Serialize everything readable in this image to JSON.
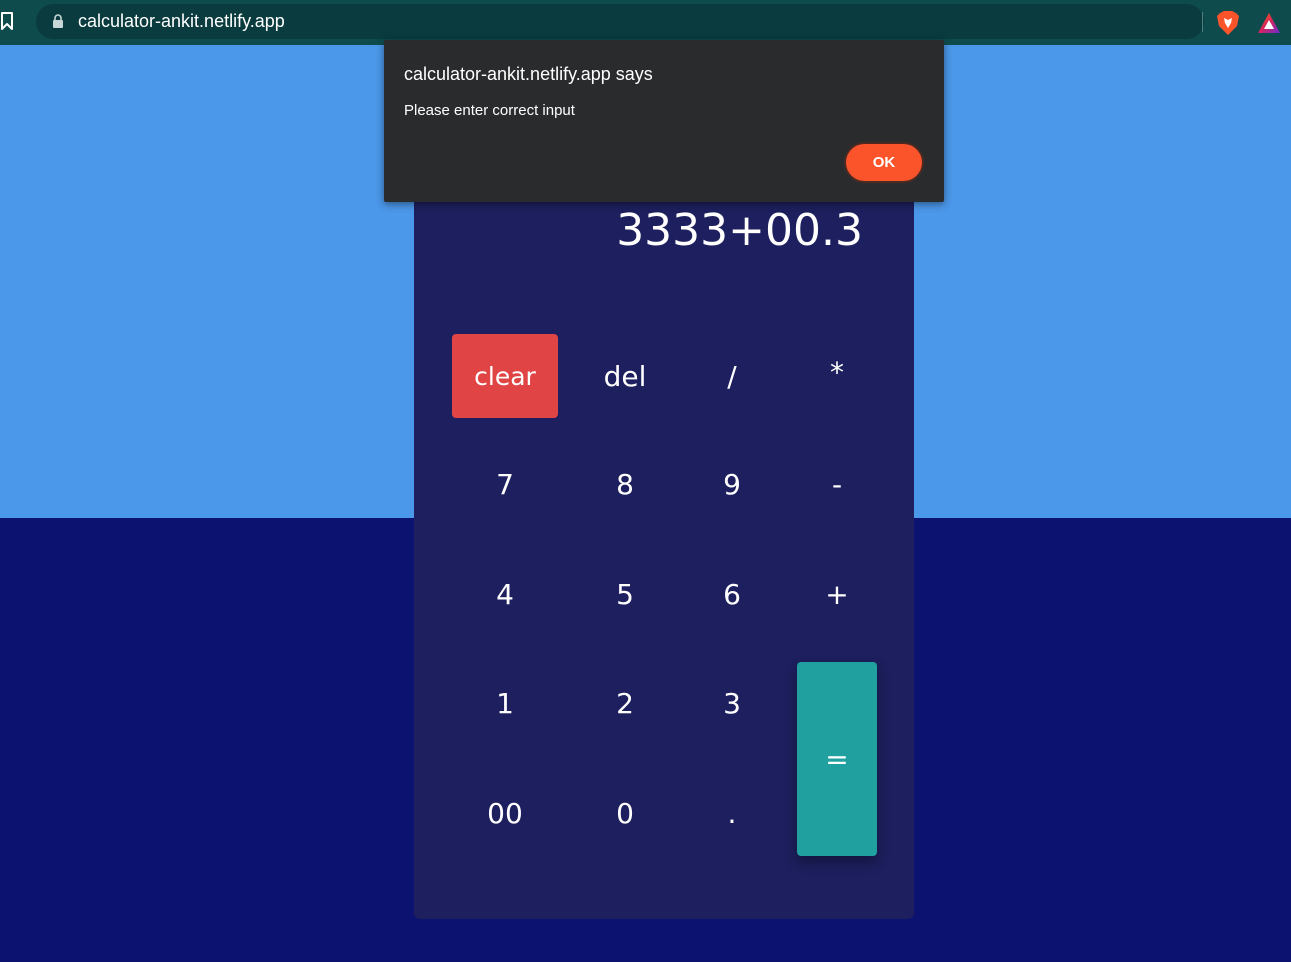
{
  "browser": {
    "url": "calculator-ankit.netlify.app",
    "icons": [
      "bookmark-icon",
      "lock-icon",
      "brave-shields-icon",
      "brave-rewards-icon"
    ]
  },
  "calculator": {
    "display_value": "3333+00.3",
    "keys": {
      "clear": "clear",
      "del": "del",
      "divide": "/",
      "multiply": "*",
      "seven": "7",
      "eight": "8",
      "nine": "9",
      "minus": "-",
      "four": "4",
      "five": "5",
      "six": "6",
      "plus": "+",
      "one": "1",
      "two": "2",
      "three": "3",
      "equals": "=",
      "double_zero": "00",
      "zero": "0",
      "decimal": "."
    }
  },
  "alert": {
    "title": "calculator-ankit.netlify.app says",
    "message": "Please enter correct input",
    "ok_label": "OK"
  },
  "colors": {
    "browser_bar": "#0e4b4d",
    "page_top": "#4b97e9",
    "page_bottom": "#0c1270",
    "calculator_body": "#1d1f5e",
    "clear_key": "#e04444",
    "equals_key": "#21a0a0",
    "dialog_bg": "#2a2b2d",
    "ok_button": "#fb542b"
  }
}
